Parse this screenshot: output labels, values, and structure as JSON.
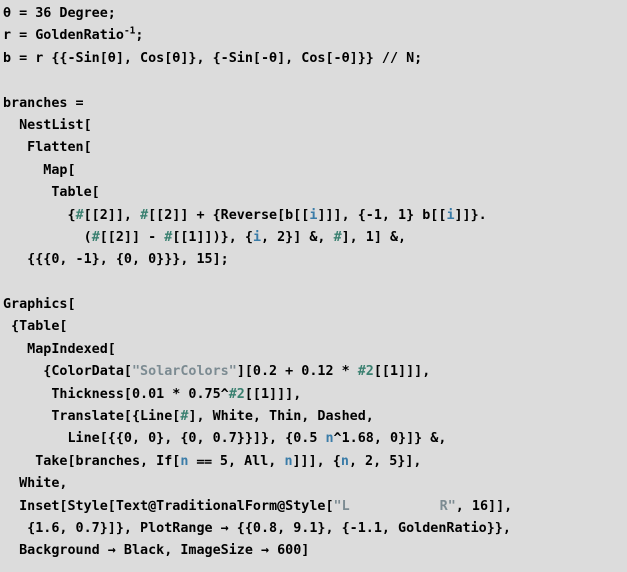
{
  "cell": {
    "kind": "mathematica-input-cell",
    "background_color": "#dcdcdc",
    "text_color": "#000000",
    "slot_color": "#3a8070",
    "local_color": "#3a7ca8",
    "string_color": "#7c8b92"
  },
  "lines": [
    {
      "id": "l01",
      "text": "θ = 36 Degree;"
    },
    {
      "id": "l02",
      "pre": "r = GoldenRatio",
      "sup": "-1",
      "post": ";"
    },
    {
      "id": "l03",
      "text": "b = r {{-Sin[θ], Cos[θ]}, {-Sin[-θ], Cos[-θ]}} // N;"
    },
    {
      "id": "l04",
      "text": ""
    },
    {
      "id": "l05",
      "text": "branches ="
    },
    {
      "id": "l06",
      "text": "  NestList["
    },
    {
      "id": "l07",
      "text": "   Flatten["
    },
    {
      "id": "l08",
      "text": "     Map["
    },
    {
      "id": "l09",
      "text": "      Table["
    },
    {
      "id": "l10",
      "a": "        {",
      "slot1": "#",
      "b": "[[2]], ",
      "slot2": "#",
      "c": "[[2]] + {Reverse[b[[",
      "loc1": "i",
      "d": "]]], {-1, 1} b[[",
      "loc2": "i",
      "e": "]]}."
    },
    {
      "id": "l11",
      "a": "          (",
      "slot1": "#",
      "b": "[[2]] - ",
      "slot2": "#",
      "c": "[[1]])}, {",
      "loc1": "i",
      "d": ", 2}] &, ",
      "slot3": "#",
      "e": "], 1] &,"
    },
    {
      "id": "l12",
      "text": "   {{{0, -1}, {0, 0}}}, 15];"
    },
    {
      "id": "l13",
      "text": ""
    },
    {
      "id": "l14",
      "text": "Graphics["
    },
    {
      "id": "l15",
      "text": " {Table["
    },
    {
      "id": "l16",
      "text": "   MapIndexed["
    },
    {
      "id": "l17",
      "a": "     {ColorData[",
      "str": "\"SolarColors\"",
      "b": "][0.2 + 0.12 * ",
      "slot1": "#2",
      "c": "[[1]]],"
    },
    {
      "id": "l18",
      "a": "      Thickness[0.01 * 0.75^",
      "slot1": "#2",
      "b": "[[1]]],"
    },
    {
      "id": "l19",
      "a": "      Translate[{Line[",
      "slot1": "#",
      "b": "], White, Thin, Dashed,"
    },
    {
      "id": "l20",
      "a": "        Line[{{0, 0}, {0, 0.7}}]}, {0.5 ",
      "loc1": "n",
      "b": "^1.68, 0}]} &,"
    },
    {
      "id": "l21",
      "a": "    Take[branches, If[",
      "loc1": "n",
      "b": " ⩵ 5, All, ",
      "loc2": "n",
      "c": "]]], {",
      "loc3": "n",
      "d": ", 2, 5}],"
    },
    {
      "id": "l22",
      "text": "  White,"
    },
    {
      "id": "l23",
      "a": "  Inset[Style[Text@TraditionalForm@Style[",
      "str_open": "\"L",
      "gap": "",
      "str_close": "R\"",
      "b": ", 16]],"
    },
    {
      "id": "l24",
      "text": "   {1.6, 0.7}]}, PlotRange → {{0.8, 9.1}, {-1.1, GoldenRatio}},"
    },
    {
      "id": "l25",
      "text": "  Background → Black, ImageSize → 600]"
    }
  ]
}
